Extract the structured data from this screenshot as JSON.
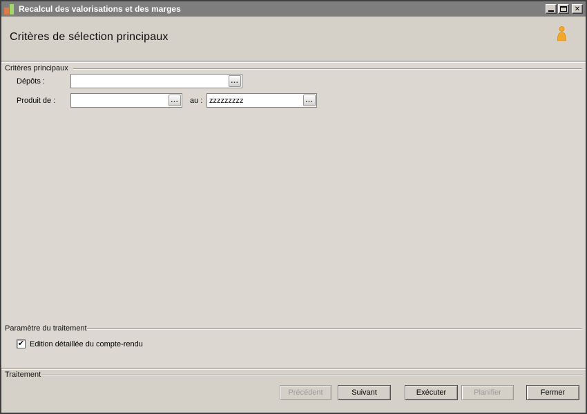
{
  "window": {
    "title": "Recalcul des valorisations et des marges"
  },
  "header": {
    "title": "Critères de sélection principaux"
  },
  "icons": {
    "app": "bar-chart-icon",
    "header_user": "person-icon",
    "close_glyph": "✕",
    "ellipsis": "...",
    "check": "✔"
  },
  "main": {
    "group_label": "Critères principaux",
    "fields": {
      "depots": {
        "label": "Dépôts :",
        "value": ""
      },
      "produit_de": {
        "label": "Produit de :",
        "value": ""
      },
      "au": {
        "label": "au :",
        "value": "zzzzzzzzz"
      }
    },
    "params": {
      "group_label": "Paramètre du traitement",
      "checkbox": {
        "label": "Edition détaillée du compte-rendu",
        "checked": true
      }
    }
  },
  "footer": {
    "group_label": "Traitement",
    "buttons": [
      {
        "label": "Précédent",
        "enabled": false
      },
      {
        "label": "Suivant",
        "enabled": true
      },
      {
        "label": "Exécuter",
        "enabled": true
      },
      {
        "label": "Planifier",
        "enabled": false
      },
      {
        "label": "Fermer",
        "enabled": true
      }
    ]
  },
  "colors": {
    "titlebar": "#7e7e7e",
    "face": "#d5d1c9",
    "content": "#dcd8d1",
    "icon_orange": "#e0794a",
    "icon_green": "#a5d66a",
    "person_orange": "#f2a72e"
  }
}
